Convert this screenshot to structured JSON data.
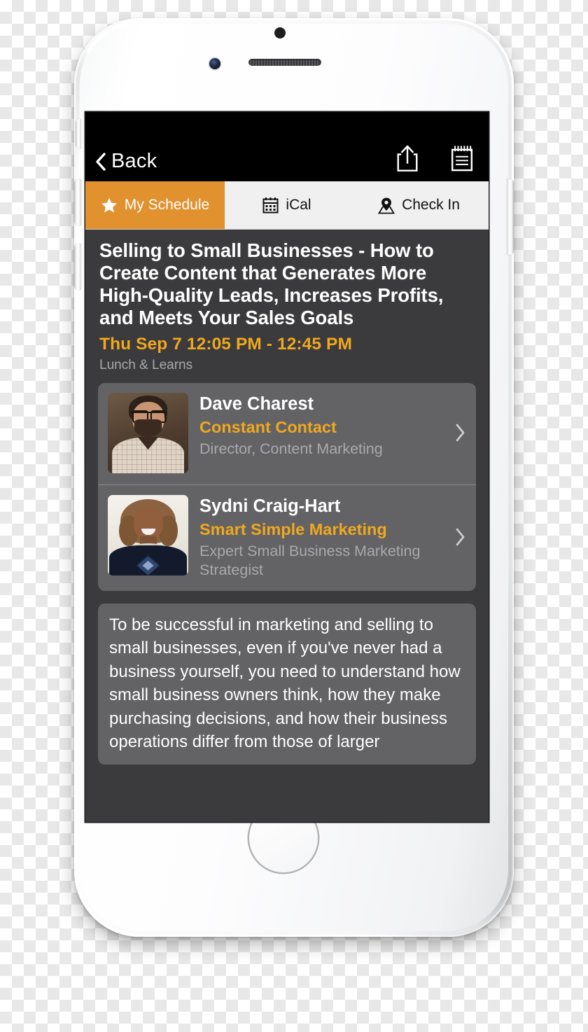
{
  "navbar": {
    "back_label": "Back",
    "back_icon": "chevron-left-icon",
    "share_icon": "share-icon",
    "notes_icon": "notepad-icon"
  },
  "tabs": [
    {
      "label": "My Schedule",
      "icon": "star-icon",
      "active": true
    },
    {
      "label": "iCal",
      "icon": "calendar-icon",
      "active": false
    },
    {
      "label": "Check In",
      "icon": "map-pin-icon",
      "active": false
    }
  ],
  "event": {
    "title": "Selling to Small Businesses - How to Create Content that Generates More High-Quality Leads, Increases Profits, and Meets Your Sales Goals",
    "day": "Thu",
    "date_time": "Sep 7 12:05 PM - 12:45 PM",
    "time_line": "Thu  Sep 7 12:05 PM - 12:45 PM",
    "track": "Lunch & Learns"
  },
  "speakers": [
    {
      "name": "Dave Charest",
      "organization": "Constant Contact",
      "role": "Director, Content Marketing",
      "avatar": "speaker-photo-dave-charest",
      "chevron": "chevron-right-icon"
    },
    {
      "name": "Sydni Craig-Hart",
      "organization": "Smart Simple Marketing",
      "role": "Expert  Small Business Marketing Strategist",
      "avatar": "speaker-photo-sydni-craig-hart",
      "chevron": "chevron-right-icon"
    }
  ],
  "description": {
    "text": "To be successful in marketing and selling to small businesses, even if you've never had a business yourself, you need to understand how small business owners think, how they make purchasing decisions, and how their business operations differ from those of larger"
  },
  "colors": {
    "accent_orange": "#e2912f",
    "accent_amber": "#f0a81e",
    "page_background": "#3b3b3d",
    "card_background": "#636366",
    "navbar_background": "#000000",
    "tabbar_background": "#f0f0f0",
    "muted_text": "#a9a9ab"
  },
  "device": {
    "model_style": "white-smartphone-mockup",
    "home_button": "home-button",
    "front_camera": "front-camera",
    "earpiece": "earpiece-speaker"
  }
}
